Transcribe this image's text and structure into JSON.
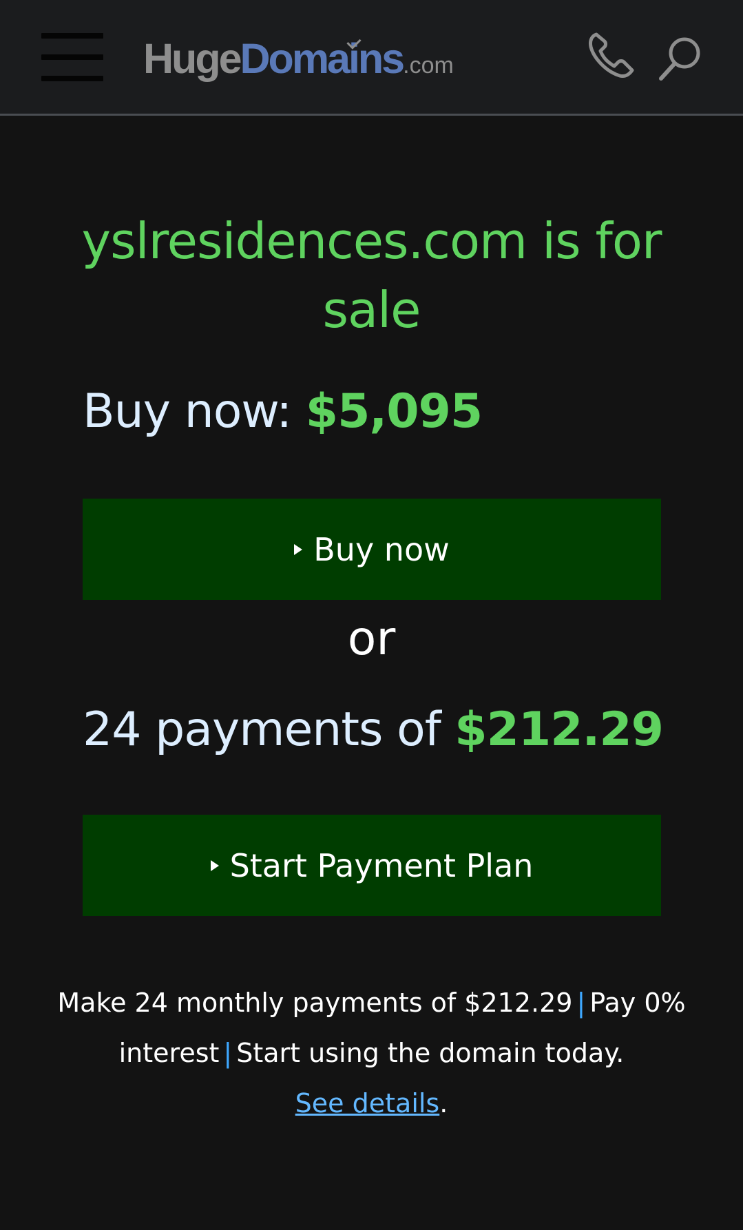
{
  "header": {
    "logo": {
      "huge": "Huge",
      "domains": "Domains",
      "com": ".com"
    },
    "icons": {
      "menu": "hamburger-menu-icon",
      "phone": "phone-icon",
      "search": "search-icon"
    }
  },
  "main": {
    "title": "yslresidences.com is for sale",
    "buy_now": {
      "label": "Buy now:",
      "amount": "$5,095"
    },
    "buy_button_label": "Buy now",
    "or_text": "or",
    "payments": {
      "label": "24 payments of",
      "amount": "$212.29"
    },
    "plan_button_label": "Start Payment Plan",
    "details": {
      "part1": "Make 24 monthly payments of $212.29",
      "separator": "|",
      "part2": "Pay 0% interest",
      "part3": "Start using the domain today.",
      "link_text": "See details",
      "period": "."
    }
  },
  "colors": {
    "background": "#131313",
    "header_bg": "#1b1c1e",
    "accent_green": "#5fd35f",
    "button_green": "#003d00",
    "link_blue": "#63b8ff",
    "logo_blue": "#5a79b8"
  }
}
